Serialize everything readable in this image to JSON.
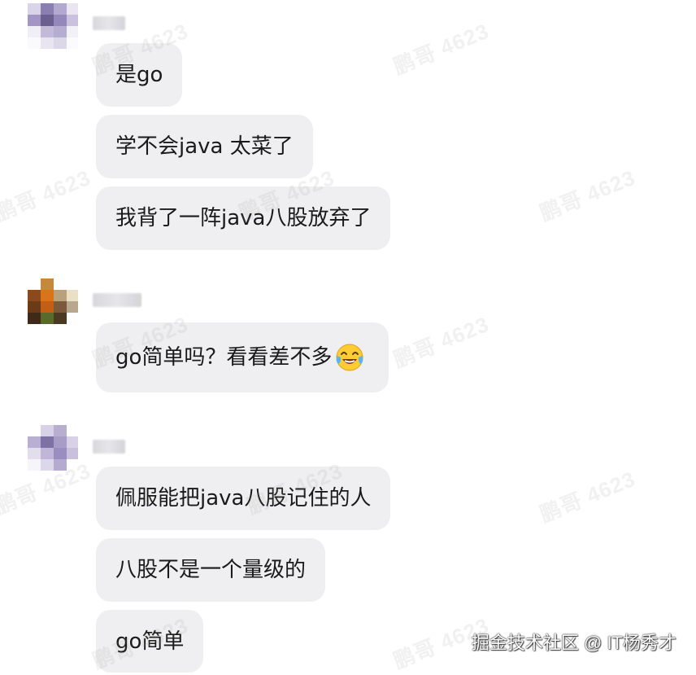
{
  "watermark_text": "鹏哥 4623",
  "footer": {
    "text": "掘金技术社区 @ IT杨秀才"
  },
  "groups": [
    {
      "messages": [
        "是go",
        "学不会java 太菜了",
        "我背了一阵java八股放弃了"
      ]
    },
    {
      "messages": [
        "go简单吗？看看差不多"
      ],
      "emoji": "laughing-crying-emoji"
    },
    {
      "messages": [
        "佩服能把java八股记住的人",
        "八股不是一个量级的",
        "go简单"
      ]
    }
  ],
  "colors": {
    "bubble": "#efeff1",
    "text": "#1a1a1a",
    "background": "#ffffff"
  }
}
